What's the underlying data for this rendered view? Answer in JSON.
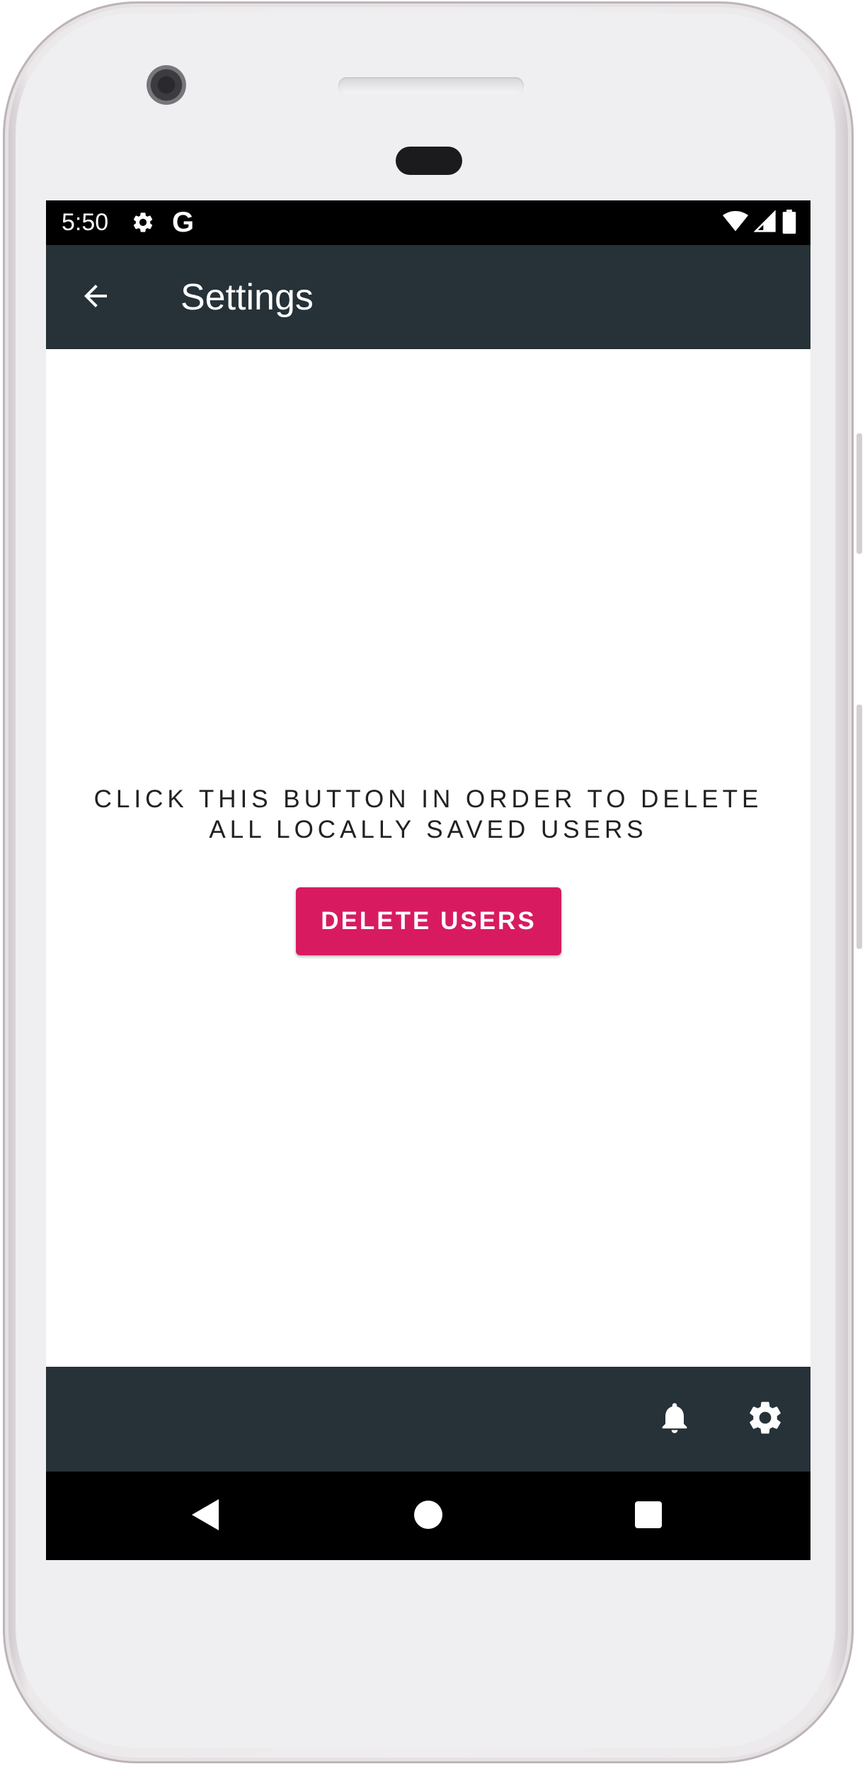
{
  "status_bar": {
    "time": "5:50",
    "left_icons": [
      "gear-icon",
      "google-g-icon"
    ],
    "google_glyph": "G",
    "right_icons": [
      "wifi-icon",
      "cell-signal-icon",
      "battery-icon"
    ]
  },
  "app_bar": {
    "title": "Settings",
    "back_icon": "arrow-back-icon",
    "background_color": "#263238"
  },
  "main": {
    "instruction_text": "CLICK THIS BUTTON IN ORDER TO DELETE ALL LOCALLY SAVED USERS",
    "delete_button_label": "DELETE USERS",
    "delete_button_color": "#d81b60"
  },
  "bottom_bar": {
    "icons": [
      "notifications-bell-icon",
      "settings-gear-icon"
    ],
    "background_color": "#263238"
  },
  "nav_bar": {
    "buttons": [
      "nav-back-triangle",
      "nav-home-circle",
      "nav-recents-square"
    ]
  }
}
